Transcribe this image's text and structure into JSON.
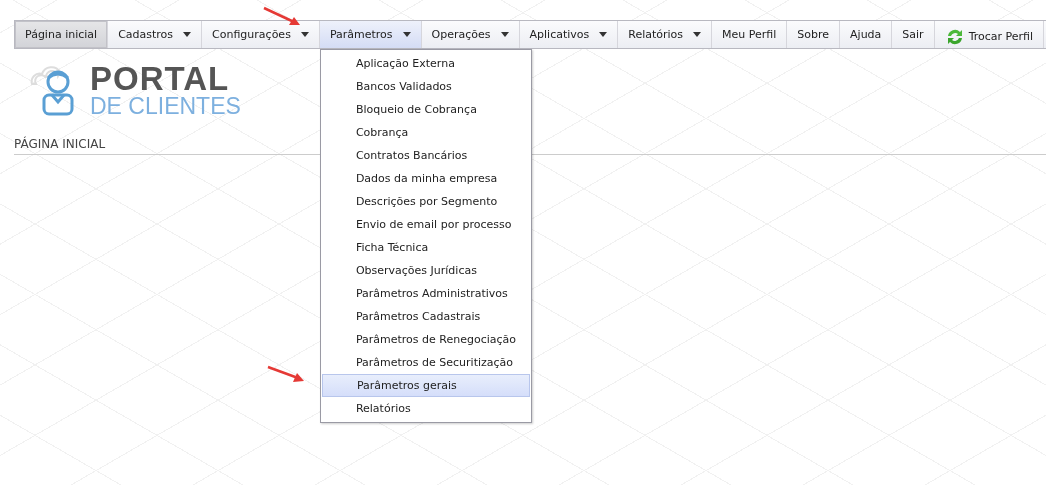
{
  "nav": {
    "items": [
      {
        "label": "Página inicial",
        "kind": "link",
        "selected": true,
        "expanded": false
      },
      {
        "label": "Cadastros",
        "kind": "dropdown",
        "selected": false,
        "expanded": false
      },
      {
        "label": "Configurações",
        "kind": "dropdown",
        "selected": false,
        "expanded": false
      },
      {
        "label": "Parâmetros",
        "kind": "dropdown",
        "selected": false,
        "expanded": true,
        "menu": [
          {
            "label": "Aplicação Externa",
            "selected": false
          },
          {
            "label": "Bancos Validados",
            "selected": false
          },
          {
            "label": "Bloqueio de Cobrança",
            "selected": false
          },
          {
            "label": "Cobrança",
            "selected": false
          },
          {
            "label": "Contratos Bancários",
            "selected": false
          },
          {
            "label": "Dados da minha empresa",
            "selected": false
          },
          {
            "label": "Descrições por Segmento",
            "selected": false
          },
          {
            "label": "Envio de email por processo",
            "selected": false
          },
          {
            "label": "Ficha Técnica",
            "selected": false
          },
          {
            "label": "Observações Jurídicas",
            "selected": false
          },
          {
            "label": "Parâmetros Administrativos",
            "selected": false
          },
          {
            "label": "Parâmetros Cadastrais",
            "selected": false
          },
          {
            "label": "Parâmetros de Renegociação",
            "selected": false
          },
          {
            "label": "Parâmetros de Securitização",
            "selected": false
          },
          {
            "label": "Parâmetros gerais",
            "selected": true
          },
          {
            "label": "Relatórios",
            "selected": false
          }
        ]
      },
      {
        "label": "Operações",
        "kind": "dropdown",
        "selected": false,
        "expanded": false
      },
      {
        "label": "Aplicativos",
        "kind": "dropdown",
        "selected": false,
        "expanded": false
      },
      {
        "label": "Relatórios",
        "kind": "dropdown",
        "selected": false,
        "expanded": false
      },
      {
        "label": "Meu Perfil",
        "kind": "link",
        "selected": false,
        "expanded": false
      },
      {
        "label": "Sobre",
        "kind": "link",
        "selected": false,
        "expanded": false
      },
      {
        "label": "Ajuda",
        "kind": "link",
        "selected": false,
        "expanded": false
      },
      {
        "label": "Sair",
        "kind": "link",
        "selected": false,
        "expanded": false
      },
      {
        "label": "Trocar Perfil",
        "kind": "swap",
        "selected": false,
        "expanded": false
      }
    ]
  },
  "logo": {
    "line_1": "PORTAL",
    "line_2": "DE CLIENTES"
  },
  "page_title": "PÁGINA INICIAL"
}
